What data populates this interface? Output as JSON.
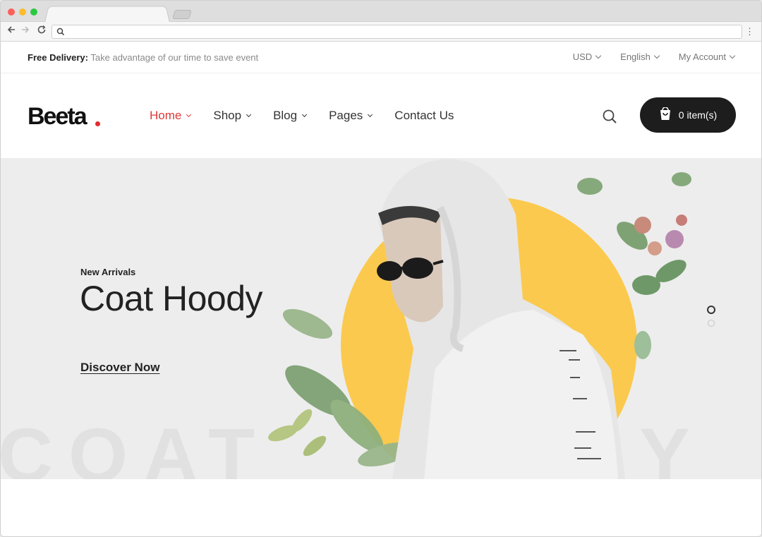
{
  "topbar": {
    "promo_label": "Free Delivery:",
    "promo_text": "Take advantage of our time to save event",
    "currency": "USD",
    "language": "English",
    "account": "My Account"
  },
  "header": {
    "logo": "Beeta",
    "nav": [
      {
        "label": "Home"
      },
      {
        "label": "Shop"
      },
      {
        "label": "Blog"
      },
      {
        "label": "Pages"
      },
      {
        "label": "Contact Us"
      }
    ],
    "cart_label": "0 item(s)"
  },
  "hero": {
    "eyebrow": "New Arrivals",
    "title": "Coat Hoody",
    "cta": "Discover Now",
    "background_word_left": "COAT",
    "background_word_right": "Y",
    "accent_color": "#fbc94e",
    "active_slide": 1,
    "slide_count": 2
  },
  "colors": {
    "active_nav": "#d93a37",
    "cart_bg": "#1d1d1d",
    "logo_dot": "#e32c2c"
  }
}
